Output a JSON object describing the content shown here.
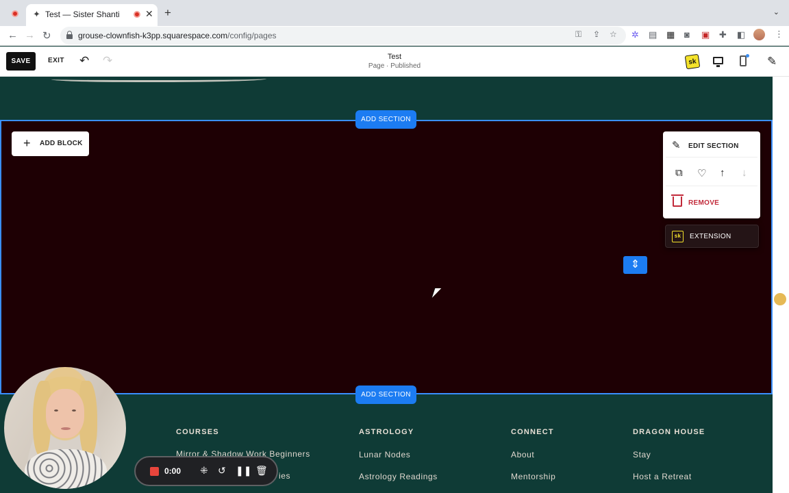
{
  "browser": {
    "tab_title": "Test — Sister Shanti",
    "url_host": "grouse-clownfish-k3pp.squarespace.com",
    "url_path": "/config/pages"
  },
  "editor": {
    "save_label": "SAVE",
    "exit_label": "EXIT",
    "page_title": "Test",
    "page_status": "Page · Published",
    "extension_logo": "sk"
  },
  "canvas": {
    "add_section_label": "ADD SECTION",
    "add_block_label": "ADD BLOCK",
    "section_panel": {
      "edit_label": "EDIT SECTION",
      "remove_label": "REMOVE"
    },
    "extension_label": "EXTENSION",
    "extension_logo": "sk"
  },
  "footer": {
    "columns": [
      {
        "heading": "COURSES",
        "links": [
          "Mirror & Shadow Work Beginners",
          "ies"
        ]
      },
      {
        "heading": "ASTROLOGY",
        "links": [
          "Lunar Nodes",
          "Astrology Readings"
        ]
      },
      {
        "heading": "CONNECT",
        "links": [
          "About",
          "Mentorship"
        ]
      },
      {
        "heading": "DRAGON HOUSE",
        "links": [
          "Stay",
          "Host a Retreat"
        ]
      }
    ]
  },
  "recorder": {
    "time": "0:00"
  },
  "colors": {
    "accent": "#1c7cf2",
    "section_bg": "#1e0004",
    "page_bg": "#0f3b36",
    "remove": "#c22a3a"
  }
}
